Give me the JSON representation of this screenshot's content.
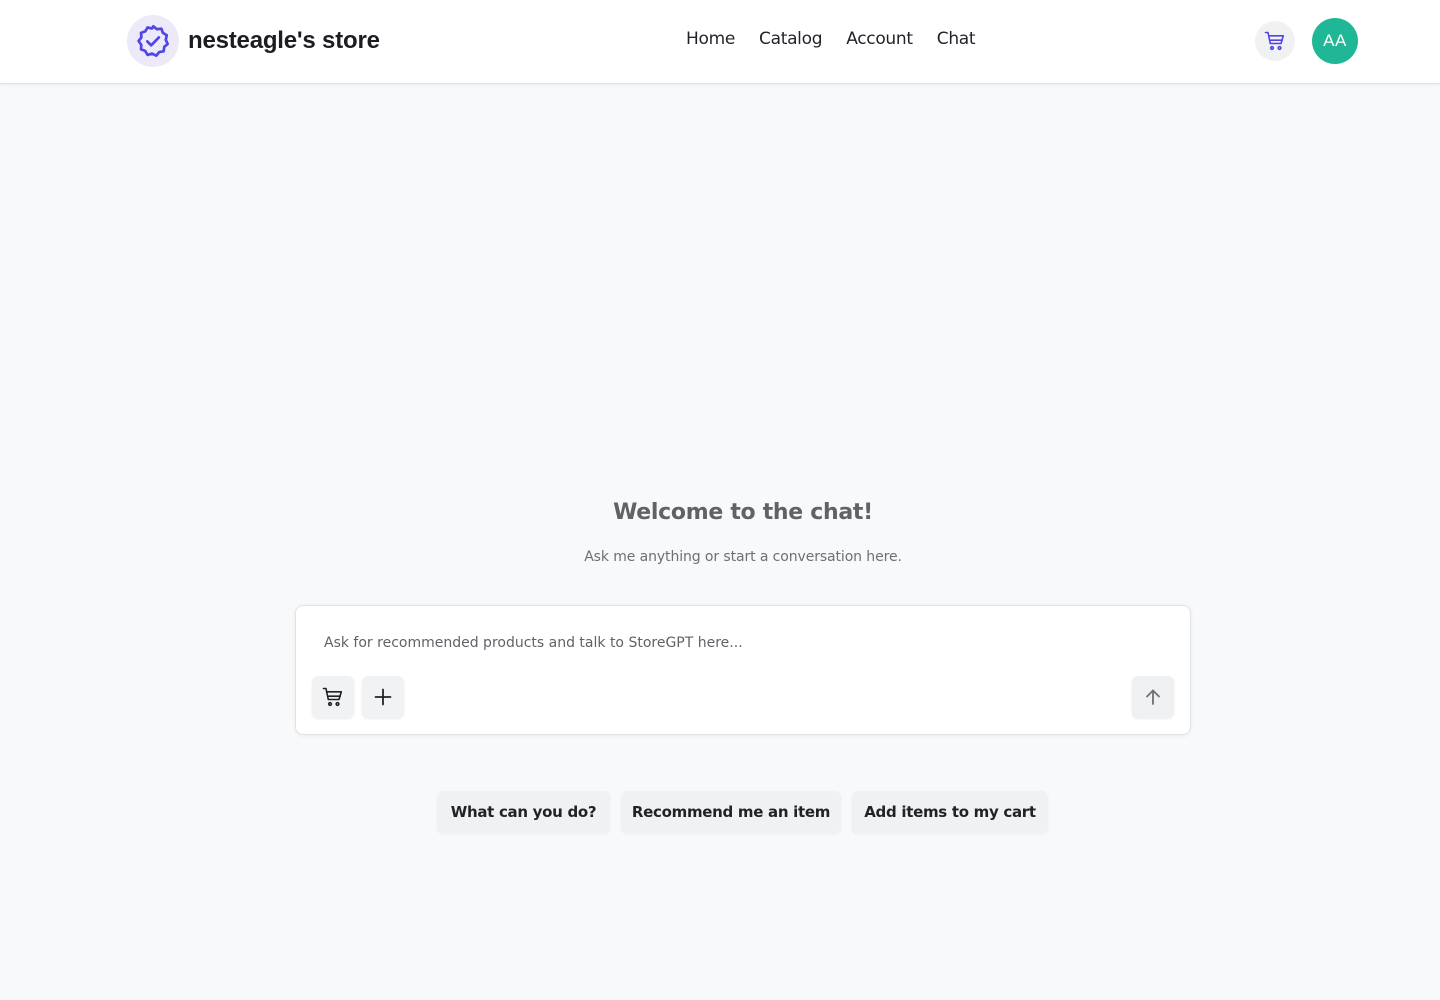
{
  "header": {
    "brand_name": "nesteagle's store",
    "brand_icon": "verified-badge-icon",
    "nav": [
      {
        "label": "Home"
      },
      {
        "label": "Catalog"
      },
      {
        "label": "Account"
      },
      {
        "label": "Chat"
      }
    ],
    "cart_icon": "cart-icon",
    "avatar_initials": "AA"
  },
  "chat": {
    "welcome_title": "Welcome to the chat!",
    "welcome_subtitle": "Ask me anything or start a conversation here.",
    "input_placeholder": "Ask for recommended products and talk to StoreGPT here...",
    "input_value": "",
    "tools": [
      {
        "icon": "cart-icon"
      },
      {
        "icon": "plus-icon"
      }
    ],
    "send_icon": "arrow-up-icon",
    "suggestions": [
      {
        "label": "What can you do?"
      },
      {
        "label": "Recommend me an item"
      },
      {
        "label": "Add items to my cart"
      }
    ]
  },
  "colors": {
    "page_background": "#f8f9fa",
    "accent": "#4f46e5",
    "avatar": "#1fb796",
    "header_background": "#ffffff"
  }
}
